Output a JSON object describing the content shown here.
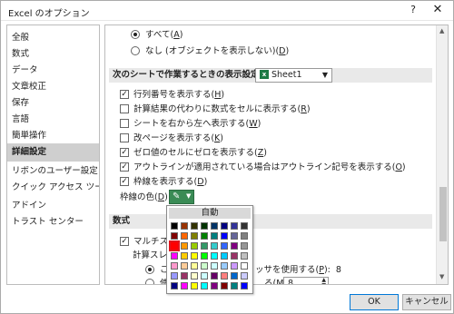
{
  "window": {
    "title": "Excel のオプション",
    "help_icon": "?",
    "close_icon": "✕"
  },
  "sidebar": {
    "items": [
      {
        "label": "全般"
      },
      {
        "label": "数式"
      },
      {
        "label": "データ"
      },
      {
        "label": "文章校正"
      },
      {
        "label": "保存"
      },
      {
        "label": "言語"
      },
      {
        "label": "簡単操作"
      },
      {
        "label": "詳細設定",
        "selected": true
      },
      {
        "label": "リボンのユーザー設定"
      },
      {
        "label": "クイック アクセス ツール バー"
      },
      {
        "label": "アドイン"
      },
      {
        "label": "トラスト センター"
      }
    ]
  },
  "objects_display": {
    "options": [
      {
        "label": "すべて",
        "key": "A",
        "checked": true
      },
      {
        "label": "なし (オブジェクトを表示しない)",
        "key": "D",
        "checked": false
      }
    ]
  },
  "sheet_section": {
    "label": "次のシートで作業するときの表示設定",
    "key": "S",
    "sheet_value": "Sheet1",
    "options": [
      {
        "label": "行列番号を表示する",
        "key": "H",
        "checked": true
      },
      {
        "label": "計算結果の代わりに数式をセルに表示する",
        "key": "R",
        "checked": false
      },
      {
        "label": "シートを右から左へ表示する",
        "key": "W",
        "checked": false
      },
      {
        "label": "改ページを表示する",
        "key": "K",
        "checked": false
      },
      {
        "label": "ゼロ値のセルにゼロを表示する",
        "key": "Z",
        "checked": true
      },
      {
        "label": "アウトラインが適用されている場合はアウトライン記号を表示する",
        "key": "O",
        "checked": true
      },
      {
        "label": "枠線を表示する",
        "key": "D",
        "checked": true
      }
    ],
    "gridline_color_label": "枠線の色",
    "gridline_color_key": "D"
  },
  "formula_section": {
    "label": "数式",
    "multithread_label": "マルチスレッ",
    "threads_label": "計算スレッ",
    "proc_text": "ッサを使用する",
    "proc_key": "P",
    "proc_value": "8",
    "manual_key": "M",
    "manual_value": "8",
    "radio1": "こ",
    "radio2": "使"
  },
  "palette": {
    "auto_label": "自動",
    "rows": [
      [
        "#000000",
        "#993300",
        "#333300",
        "#003300",
        "#003366",
        "#000080",
        "#333399",
        "#333333"
      ],
      [
        "#800000",
        "#FF6600",
        "#808000",
        "#008000",
        "#008080",
        "#0000FF",
        "#666699",
        "#808080"
      ],
      [
        "#FF0000",
        "#FF9900",
        "#99CC00",
        "#339966",
        "#33CCCC",
        "#3366FF",
        "#800080",
        "#969696"
      ],
      [
        "#FF00FF",
        "#FFCC00",
        "#FFFF00",
        "#00FF00",
        "#00FFFF",
        "#00CCFF",
        "#993366",
        "#C0C0C0"
      ],
      [
        "#FF99CC",
        "#FFCC99",
        "#FFFF99",
        "#CCFFCC",
        "#CCFFFF",
        "#99CCFF",
        "#CC99FF",
        "#FFFFFF"
      ],
      [
        "#9999FF",
        "#993366",
        "#FFFFCC",
        "#CCFFFF",
        "#660066",
        "#FF8080",
        "#0066CC",
        "#CCCCFF"
      ],
      [
        "#000080",
        "#FF00FF",
        "#FFFF00",
        "#00FFFF",
        "#800080",
        "#800000",
        "#008080",
        "#0000FF"
      ]
    ],
    "highlighted": [
      2,
      0
    ]
  },
  "footer": {
    "ok_label": "OK",
    "cancel_label": "キャンセル"
  },
  "colors": {
    "accent_green": "#3a8b55",
    "highlight_red": "#e0141b",
    "selected_bg": "#cfcfcf"
  }
}
